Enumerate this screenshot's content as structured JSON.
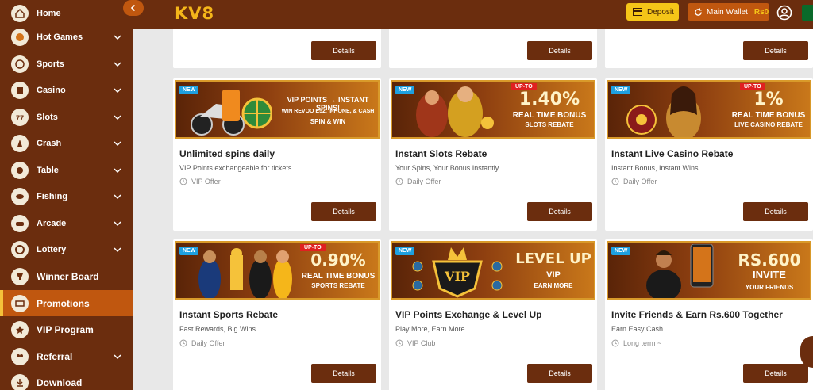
{
  "sidebar": {
    "items": [
      {
        "label": "Home",
        "icon": "home-icon",
        "dropdown": false
      },
      {
        "label": "Hot Games",
        "icon": "hot-games-icon",
        "dropdown": true
      },
      {
        "label": "Sports",
        "icon": "sports-icon",
        "dropdown": true
      },
      {
        "label": "Casino",
        "icon": "casino-icon",
        "dropdown": true
      },
      {
        "label": "Slots",
        "icon": "slots-icon",
        "dropdown": true
      },
      {
        "label": "Crash",
        "icon": "crash-icon",
        "dropdown": true
      },
      {
        "label": "Table",
        "icon": "table-icon",
        "dropdown": true
      },
      {
        "label": "Fishing",
        "icon": "fishing-icon",
        "dropdown": true
      },
      {
        "label": "Arcade",
        "icon": "arcade-icon",
        "dropdown": true
      },
      {
        "label": "Lottery",
        "icon": "lottery-icon",
        "dropdown": true
      },
      {
        "label": "Winner Board",
        "icon": "winner-board-icon",
        "dropdown": false
      },
      {
        "label": "Promotions",
        "icon": "promotions-icon",
        "dropdown": false,
        "active": true
      },
      {
        "label": "VIP Program",
        "icon": "vip-icon",
        "dropdown": false
      },
      {
        "label": "Referral",
        "icon": "referral-icon",
        "dropdown": true
      },
      {
        "label": "Download",
        "icon": "download-icon",
        "dropdown": false
      }
    ]
  },
  "header": {
    "logo": "KV8",
    "deposit_label": "Deposit",
    "wallet_label": "Main Wallet",
    "wallet_amount": "Rs0"
  },
  "details_label": "Details",
  "top_row_details": [
    "Details",
    "Details",
    "Details"
  ],
  "promos": [
    {
      "title": "Unlimited spins daily",
      "desc": "VIP Points exchangeable for tickets",
      "tag": "VIP Offer",
      "badge": "NEW",
      "banner_lines": [
        "VIP POINTS → INSTANT SPINS!",
        "WIN REVOO E52, IPHONE, & CASH",
        "SPIN & WIN"
      ]
    },
    {
      "title": "Instant Slots Rebate",
      "desc": "Your Spins, Your Bonus Instantly",
      "tag": "Daily Offer",
      "badge": "NEW",
      "upto": "UP-TO",
      "banner_big": "1.40%",
      "banner_lines": [
        "REAL TIME BONUS",
        "SLOTS REBATE"
      ]
    },
    {
      "title": "Instant Live Casino Rebate",
      "desc": "Instant Bonus, Instant Wins",
      "tag": "Daily Offer",
      "badge": "NEW",
      "upto": "UP-TO",
      "banner_big": "1%",
      "banner_lines": [
        "REAL TIME BONUS",
        "LIVE CASINO REBATE"
      ]
    },
    {
      "title": "Instant Sports Rebate",
      "desc": "Fast Rewards, Big Wins",
      "tag": "Daily Offer",
      "badge": "NEW",
      "upto": "UP-TO",
      "banner_big": "0.90%",
      "banner_lines": [
        "REAL TIME BONUS",
        "SPORTS REBATE"
      ]
    },
    {
      "title": "VIP Points Exchange & Level Up",
      "desc": "Play More, Earn More",
      "tag": "VIP Club",
      "badge": "NEW",
      "banner_big": "LEVEL UP",
      "banner_lines": [
        "VIP",
        "EARN MORE"
      ],
      "vip_badge": "VIP"
    },
    {
      "title": "Invite Friends & Earn Rs.600 Together",
      "desc": "Earn Easy Cash",
      "tag": "Long term ~",
      "badge": "NEW",
      "banner_big": "RS.600",
      "banner_lines": [
        "INVITE",
        "YOUR FRIENDS"
      ]
    }
  ],
  "colors": {
    "sidebar_bg": "#6b2d0e",
    "active_bg": "#c0570f",
    "deposit_bg": "#f5c518",
    "details_bg": "#6b2d0e"
  }
}
